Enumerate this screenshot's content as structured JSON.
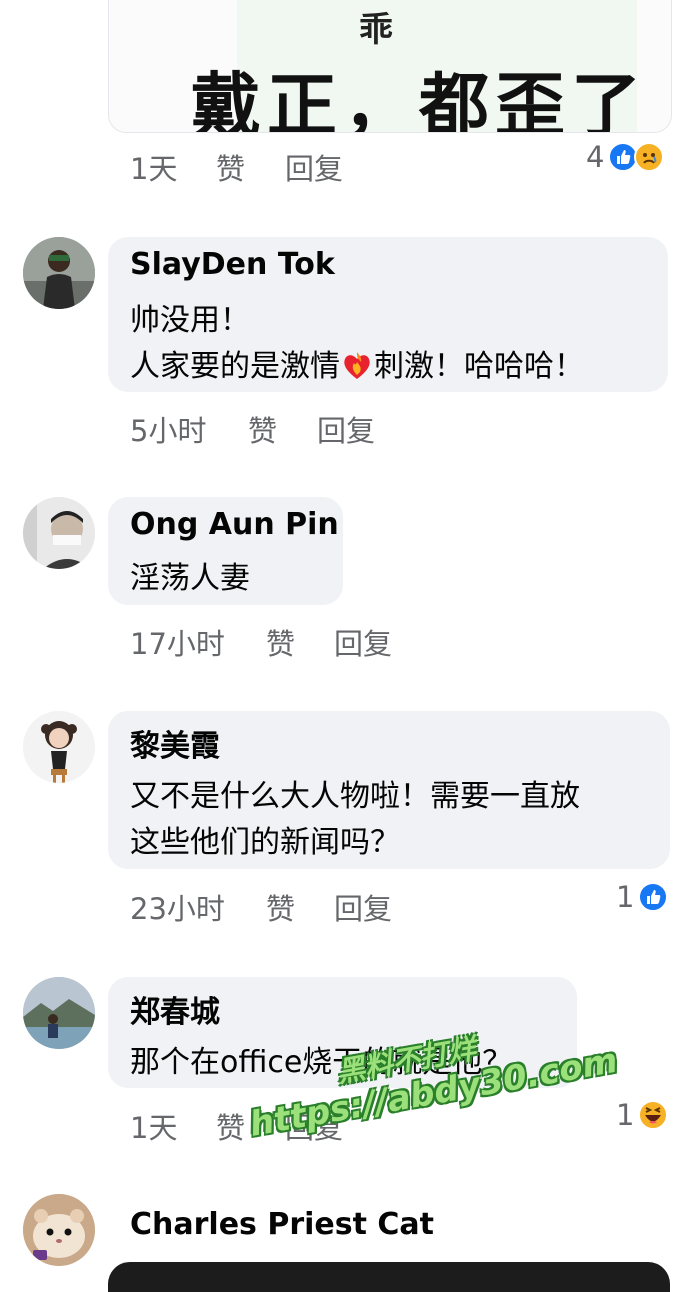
{
  "top_image": {
    "small_char": "乖",
    "big_text": "戴正，都歪了"
  },
  "top_meta": {
    "time": "1天",
    "like": "赞",
    "reply": "回复",
    "reaction_count": "4",
    "reactions": [
      "like-icon",
      "sad-icon"
    ]
  },
  "comments": [
    {
      "author": "SlayDen Tok",
      "lines": [
        "帅没用！",
        "人家要的是激情",
        "刺激！哈哈哈！"
      ],
      "time": "5小时",
      "like": "赞",
      "reply": "回复",
      "avatar_icon": "avatar-man-dark"
    },
    {
      "author": "Ong Aun Pin",
      "lines": [
        "淫荡人妻"
      ],
      "time": "17小时",
      "like": "赞",
      "reply": "回复",
      "avatar_icon": "avatar-man-grey"
    },
    {
      "author": "黎美霞",
      "lines": [
        "又不是什么大人物啦！需要一直放",
        "这些他们的新闻吗？"
      ],
      "time": "23小时",
      "like": "赞",
      "reply": "回复",
      "reaction_count": "1",
      "reactions": [
        "like-icon"
      ],
      "avatar_icon": "avatar-doll"
    },
    {
      "author": "郑春城",
      "lines": [
        "那个在office烧干的就是他？"
      ],
      "time": "1天",
      "like": "赞",
      "reply": "回复",
      "reaction_count": "1",
      "reactions": [
        "haha-icon"
      ],
      "avatar_icon": "avatar-landscape"
    },
    {
      "author": "Charles Priest Cat",
      "avatar_icon": "avatar-hamster"
    }
  ],
  "watermark": {
    "line1": "黑料不打烊",
    "line2": "https://abdy30.com"
  },
  "colors": {
    "bubble": "#f0f2f5",
    "meta_text": "#65676b",
    "like_blue": "#1877f2",
    "watermark_green": "#9be07a"
  }
}
